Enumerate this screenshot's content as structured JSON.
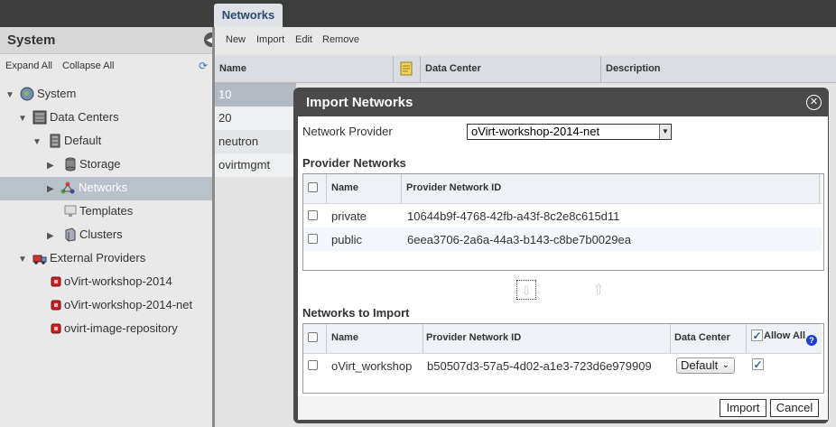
{
  "top_tab": {
    "label": "Networks"
  },
  "left_panel": {
    "title": "System",
    "expand_all": "Expand All",
    "collapse_all": "Collapse All",
    "tree": [
      {
        "label": "System",
        "icon": "globe-icon"
      },
      {
        "label": "Data Centers",
        "icon": "datacenters-icon"
      },
      {
        "label": "Default",
        "icon": "datacenter-icon"
      },
      {
        "label": "Storage",
        "icon": "storage-icon"
      },
      {
        "label": "Networks",
        "icon": "network-icon",
        "selected": true
      },
      {
        "label": "Templates",
        "icon": "template-icon"
      },
      {
        "label": "Clusters",
        "icon": "cluster-icon"
      },
      {
        "label": "External Providers",
        "icon": "truck-icon"
      },
      {
        "label": "oVirt-workshop-2014",
        "icon": "provider-icon"
      },
      {
        "label": "oVirt-workshop-2014-net",
        "icon": "provider-icon"
      },
      {
        "label": "ovirt-image-repository",
        "icon": "provider-icon"
      }
    ]
  },
  "toolbar": {
    "new": "New",
    "import": "Import",
    "edit": "Edit",
    "remove": "Remove"
  },
  "grid": {
    "columns": [
      "Name",
      "Data Center",
      "Description"
    ],
    "rows": [
      "10",
      "20",
      "neutron",
      "ovirtmgmt"
    ]
  },
  "dialog": {
    "title": "Import Networks",
    "network_provider_label": "Network Provider",
    "network_provider_value": "oVirt-workshop-2014-net",
    "provider_networks": {
      "title": "Provider Networks",
      "columns": [
        "Name",
        "Provider Network ID"
      ],
      "rows": [
        {
          "name": "private",
          "id": "10644b9f-4768-42fb-a43f-8c2e8c615d11"
        },
        {
          "name": "public",
          "id": "6eea3706-2a6a-44a3-b143-c8be7b0029ea"
        }
      ]
    },
    "networks_to_import": {
      "title": "Networks to Import",
      "columns": [
        "Name",
        "Provider Network ID",
        "Data Center",
        "Allow All"
      ],
      "rows": [
        {
          "name": "oVirt_workshop",
          "id": "b50507d3-57a5-4d02-a1e3-723d6e979909",
          "data_center": "Default",
          "allow_all": true
        }
      ]
    },
    "import_button": "Import",
    "cancel_button": "Cancel"
  }
}
